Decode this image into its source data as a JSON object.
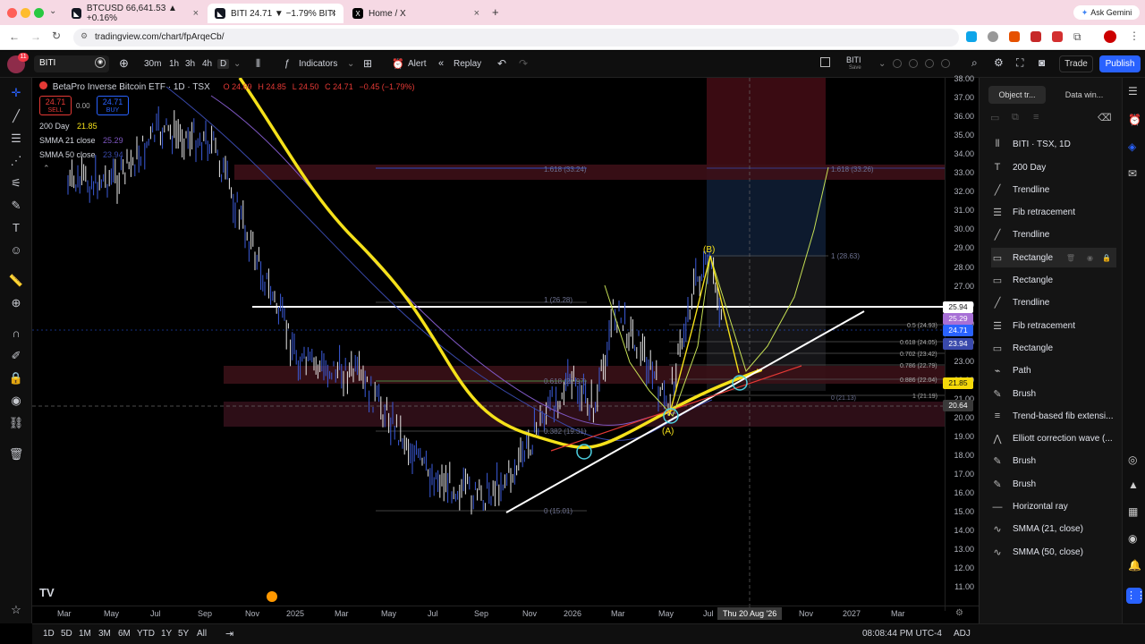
{
  "browser": {
    "tabs": [
      {
        "title": "BTCUSD 66,641.53 ▲ +0.16%"
      },
      {
        "title": "BITI 24.71 ▼ −1.79% BITI"
      },
      {
        "title": "Home / X"
      }
    ],
    "url": "tradingview.com/chart/fpArqeCb/",
    "ask_gemini": "Ask Gemini"
  },
  "toolbar": {
    "symbol": "BITI",
    "intervals": [
      "30m",
      "1h",
      "3h",
      "4h",
      "D"
    ],
    "indicators": "Indicators",
    "alert": "Alert",
    "replay": "Replay",
    "layout_name": "BITI",
    "save": "Save",
    "trade": "Trade",
    "publish": "Publish"
  },
  "legend": {
    "title": "BetaPro Inverse Bitcoin ETF · 1D · TSX",
    "ohlc": {
      "o": "O 24.69",
      "h": "H 24.85",
      "l": "L 24.50",
      "c": "C 24.71",
      "chg": "−0.45 (−1.79%)"
    },
    "sell_price": "24.71",
    "sell_label": "SELL",
    "spread": "0.00",
    "buy_price": "24.71",
    "buy_label": "BUY",
    "ind1_name": "200 Day",
    "ind1_val": "21.85",
    "ind2_name": "SMMA 21 close",
    "ind2_val": "25.29",
    "ind3_name": "SMMA 50 close",
    "ind3_val": "23.94"
  },
  "chart_labels": {
    "fib1618_a": "1.618 (33.24)",
    "fib1618_b": "1.618 (33.26)",
    "fib1_a": "1 (26.28)",
    "fib1_b": "1 (28.63)",
    "fib0618_a": "0.618 (21.97)",
    "fib0382": "0.382 (19.31)",
    "fib0_a": "0 (15.01)",
    "fib05_r": "0.5 (24.93)",
    "fib0618_r": "0.618 (24.05)",
    "fib0702_r": "0.702 (23.42)",
    "fib0786_r": "0.786 (22.79)",
    "fib0886_r": "0.886 (22.04)",
    "fib1_r": "1 (21.19)",
    "fib0_r": "0 (21.13)",
    "wave_b": "(B)",
    "wave_a": "(A)"
  },
  "price_axis": {
    "ticks": [
      "38.00",
      "37.00",
      "36.00",
      "35.00",
      "34.00",
      "33.00",
      "32.00",
      "31.00",
      "30.00",
      "29.00",
      "28.00",
      "27.00",
      "26.00",
      "25.00",
      "24.00",
      "23.00",
      "22.00",
      "21.00",
      "20.00",
      "19.00",
      "18.00",
      "17.00",
      "16.00",
      "15.00",
      "14.00",
      "13.00",
      "12.00",
      "11.00"
    ],
    "tags": [
      {
        "value": "25.94",
        "color": "#ffffff"
      },
      {
        "value": "25.29",
        "color": "#a770d6"
      },
      {
        "value": "24.71",
        "color": "#2962ff"
      },
      {
        "value": "23.94",
        "color": "#3949ab"
      },
      {
        "value": "21.85",
        "color": "#f5d90a"
      },
      {
        "value": "20.64",
        "color": "#3a3a3a"
      }
    ]
  },
  "time_axis": {
    "ticks": [
      "Mar",
      "May",
      "Jul",
      "Sep",
      "Nov",
      "2025",
      "Mar",
      "May",
      "Jul",
      "Sep",
      "Nov",
      "2026",
      "Mar",
      "May",
      "Jul",
      "Nov",
      "2027",
      "Mar"
    ],
    "crosshair": "Thu 20 Aug '26"
  },
  "right_panel": {
    "tabs": [
      "Object tr...",
      "Data win..."
    ],
    "header": "BITI · TSX, 1D",
    "objects": [
      {
        "label": "200 Day",
        "icon": "text-icon"
      },
      {
        "label": "Trendline",
        "icon": "trendline-icon"
      },
      {
        "label": "Fib retracement",
        "icon": "fib-icon"
      },
      {
        "label": "Trendline",
        "icon": "trendline-icon"
      },
      {
        "label": "Rectangle",
        "icon": "rectangle-icon"
      },
      {
        "label": "Rectangle",
        "icon": "rectangle-icon"
      },
      {
        "label": "Trendline",
        "icon": "trendline-icon"
      },
      {
        "label": "Fib retracement",
        "icon": "fib-icon"
      },
      {
        "label": "Rectangle",
        "icon": "rectangle-icon"
      },
      {
        "label": "Path",
        "icon": "path-icon"
      },
      {
        "label": "Brush",
        "icon": "brush-icon"
      },
      {
        "label": "Trend-based fib extensi...",
        "icon": "fib-ext-icon"
      },
      {
        "label": "Elliott correction wave (...",
        "icon": "elliott-icon"
      },
      {
        "label": "Brush",
        "icon": "brush-icon"
      },
      {
        "label": "Brush",
        "icon": "brush-icon"
      },
      {
        "label": "Horizontal ray",
        "icon": "hray-icon"
      },
      {
        "label": "SMMA (21, close)",
        "icon": "indicator-icon"
      },
      {
        "label": "SMMA (50, close)",
        "icon": "indicator-icon"
      }
    ]
  },
  "bottom": {
    "ranges": [
      "1D",
      "5D",
      "1M",
      "3M",
      "6M",
      "YTD",
      "1Y",
      "5Y",
      "All"
    ],
    "clock": "08:08:44 PM UTC-4",
    "adj": "ADJ"
  },
  "badge": "11"
}
